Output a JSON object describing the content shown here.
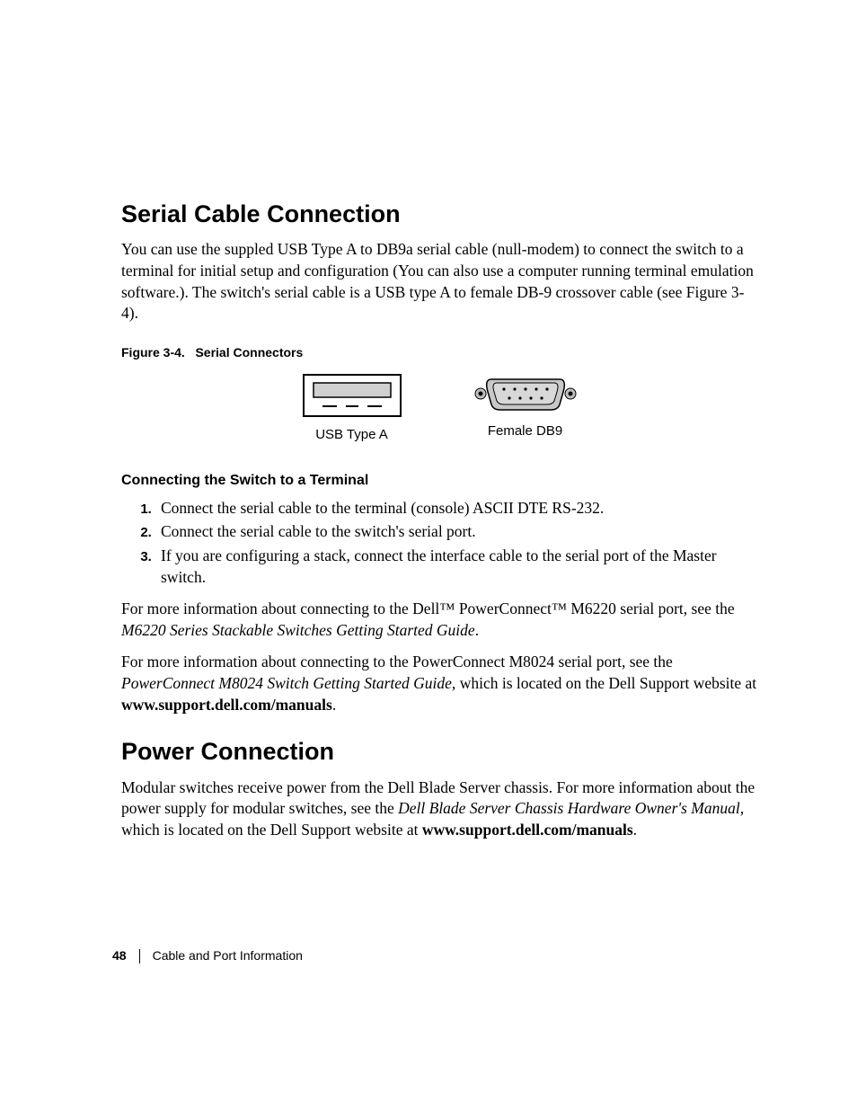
{
  "section1": {
    "title": "Serial Cable Connection",
    "intro": "You can use the suppled USB Type A to DB9a serial cable (null-modem) to connect the switch to a terminal for initial setup and configuration (You can also use a computer running terminal emulation software.). The switch's serial cable is a USB type A to female DB-9 crossover cable (see Figure 3-4)."
  },
  "figure": {
    "caption_label": "Figure 3-4.",
    "caption_text": "Serial Connectors",
    "left_label": "USB Type A",
    "right_label": "Female DB9"
  },
  "procedure": {
    "heading": "Connecting the Switch to a Terminal",
    "steps": [
      "Connect the serial cable to the terminal (console) ASCII DTE RS-232.",
      "Connect the serial cable to the switch's serial port.",
      "If you are configuring a stack, connect the interface cable to the serial port of the Master switch."
    ]
  },
  "moreinfo1": {
    "pre": "For more information about connecting to the Dell™ PowerConnect™ M6220 serial port, see the ",
    "italic": "M6220 Series Stackable Switches Getting Started Guide",
    "post": "."
  },
  "moreinfo2": {
    "pre": "For more information about connecting to the PowerConnect M8024 serial port, see the ",
    "italic": "PowerConnect M8024 Switch Getting Started Guide,",
    "mid": " which is located on the Dell Support website at ",
    "bold": "www.support.dell.com/manuals",
    "post": "."
  },
  "section2": {
    "title": "Power Connection",
    "body_pre": "Modular switches receive power from the Dell Blade Server chassis. For more information about the power supply for modular switches, see the ",
    "body_italic": "Dell Blade Server Chassis Hardware Owner's Manual,",
    "body_mid": " which is located on the Dell Support website at ",
    "body_bold": "www.support.dell.com/manuals",
    "body_post": "."
  },
  "footer": {
    "page": "48",
    "chapter": "Cable and Port Information"
  }
}
